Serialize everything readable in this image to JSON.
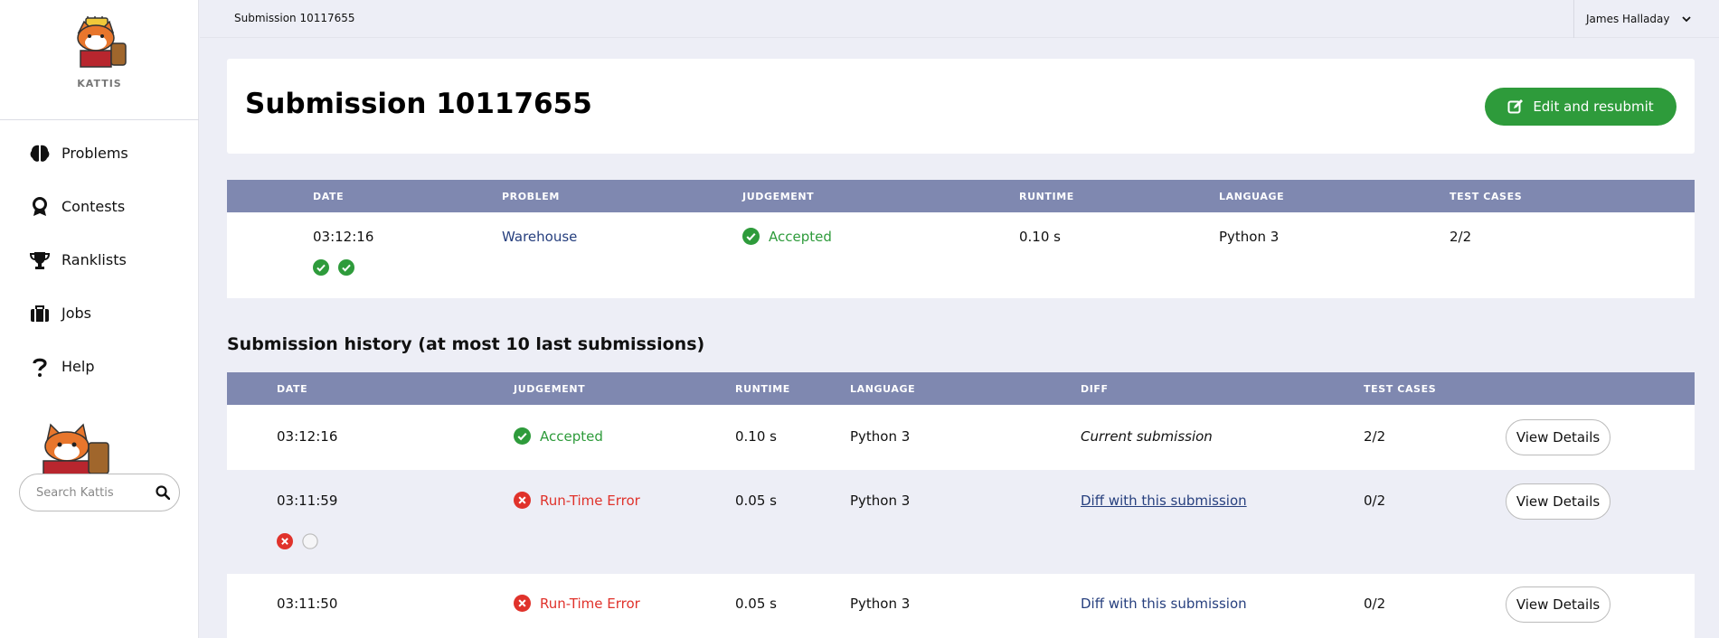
{
  "sidebar": {
    "logo_text": "KATTIS",
    "nav": [
      {
        "label": "Problems",
        "icon": "brain-icon"
      },
      {
        "label": "Contests",
        "icon": "medal-icon"
      },
      {
        "label": "Ranklists",
        "icon": "trophy-icon"
      },
      {
        "label": "Jobs",
        "icon": "briefcase-icon"
      },
      {
        "label": "Help",
        "icon": "question-icon"
      }
    ],
    "search_placeholder": "Search Kattis"
  },
  "topbar": {
    "breadcrumb": "Submission 10117655",
    "user_name": "James Halladay"
  },
  "header": {
    "title": "Submission 10117655",
    "resubmit_label": "Edit and resubmit"
  },
  "summary": {
    "columns": [
      "DATE",
      "PROBLEM",
      "JUDGEMENT",
      "RUNTIME",
      "LANGUAGE",
      "TEST CASES"
    ],
    "row": {
      "date": "03:12:16",
      "problem": "Warehouse",
      "judgement": "Accepted",
      "runtime": "0.10 s",
      "language": "Python 3",
      "test_cases": "2/2",
      "test_results": [
        "pass",
        "pass"
      ]
    }
  },
  "history": {
    "title": "Submission history (at most 10 last submissions)",
    "columns": [
      "DATE",
      "JUDGEMENT",
      "RUNTIME",
      "LANGUAGE",
      "DIFF",
      "TEST CASES"
    ],
    "view_label": "View Details",
    "rows": [
      {
        "date": "03:12:16",
        "judgement": "Accepted",
        "status": "ok",
        "runtime": "0.10 s",
        "language": "Python 3",
        "diff": "Current submission",
        "test_cases": "2/2"
      },
      {
        "date": "03:11:59",
        "judgement": "Run-Time Error",
        "status": "error",
        "runtime": "0.05 s",
        "language": "Python 3",
        "diff": "Diff with this submission",
        "test_cases": "0/2",
        "test_results": [
          "fail",
          "skip"
        ]
      },
      {
        "date": "03:11:50",
        "judgement": "Run-Time Error",
        "status": "error",
        "runtime": "0.05 s",
        "language": "Python 3",
        "diff": "Diff with this submission",
        "test_cases": "0/2"
      }
    ]
  },
  "colors": {
    "accent_green": "#2e9b3b",
    "error_red": "#e0322b",
    "table_header": "#7f88b0",
    "link": "#263f7e"
  }
}
